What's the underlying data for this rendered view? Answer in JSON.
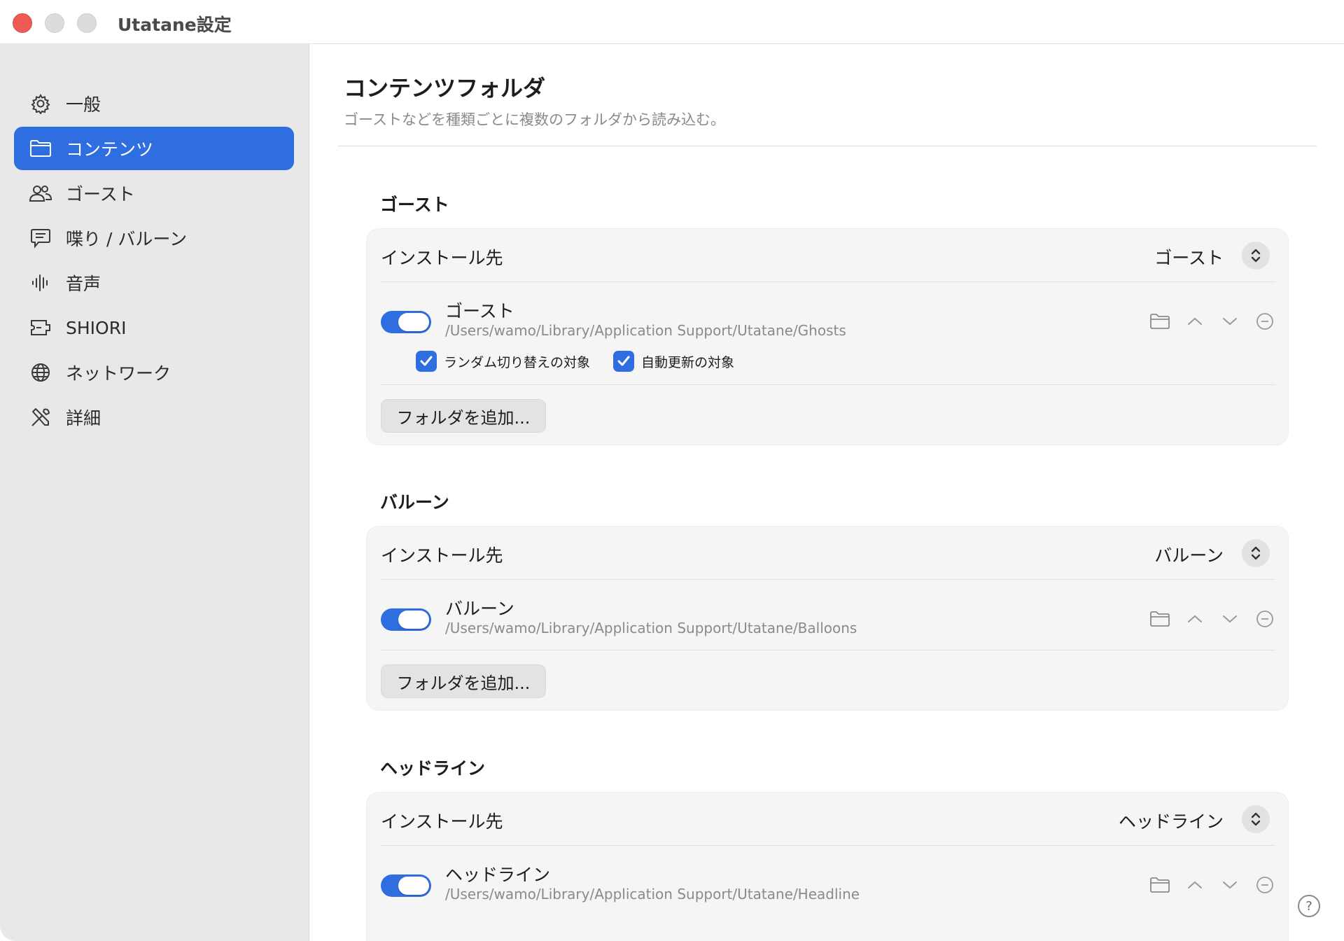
{
  "window": {
    "title": "Utatane設定"
  },
  "sidebar": {
    "items": [
      {
        "label": "一般",
        "icon": "gear-icon",
        "active": false
      },
      {
        "label": "コンテンツ",
        "icon": "folder-icon",
        "active": true
      },
      {
        "label": "ゴースト",
        "icon": "people-icon",
        "active": false
      },
      {
        "label": "喋り / バルーン",
        "icon": "speech-bubble-icon",
        "active": false
      },
      {
        "label": "音声",
        "icon": "waveform-icon",
        "active": false
      },
      {
        "label": "SHIORI",
        "icon": "plugin-icon",
        "active": false
      },
      {
        "label": "ネットワーク",
        "icon": "globe-icon",
        "active": false
      },
      {
        "label": "詳細",
        "icon": "tools-icon",
        "active": false
      }
    ]
  },
  "main": {
    "title": "コンテンツフォルダ",
    "subtitle": "ゴーストなどを種類ごとに複数のフォルダから読み込む。",
    "sections": [
      {
        "title": "ゴースト",
        "install_label": "インストール先",
        "install_value": "ゴースト",
        "folder": {
          "enabled": true,
          "name": "ゴースト",
          "path": "/Users/wamo/Library/Application Support/Utatane/Ghosts"
        },
        "checkboxes": [
          {
            "label": "ランダム切り替えの対象",
            "checked": true
          },
          {
            "label": "自動更新の対象",
            "checked": true
          }
        ],
        "add_button": "フォルダを追加..."
      },
      {
        "title": "バルーン",
        "install_label": "インストール先",
        "install_value": "バルーン",
        "folder": {
          "enabled": true,
          "name": "バルーン",
          "path": "/Users/wamo/Library/Application Support/Utatane/Balloons"
        },
        "add_button": "フォルダを追加..."
      },
      {
        "title": "ヘッドライン",
        "install_label": "インストール先",
        "install_value": "ヘッドライン",
        "folder": {
          "enabled": true,
          "name": "ヘッドライン",
          "path": "/Users/wamo/Library/Application Support/Utatane/Headline"
        }
      }
    ],
    "help_label": "?"
  },
  "colors": {
    "accent": "#2f6ee0",
    "sidebar_bg": "#e8e8e8",
    "card_bg": "#f5f5f5",
    "close_light": "#ee5b57"
  }
}
